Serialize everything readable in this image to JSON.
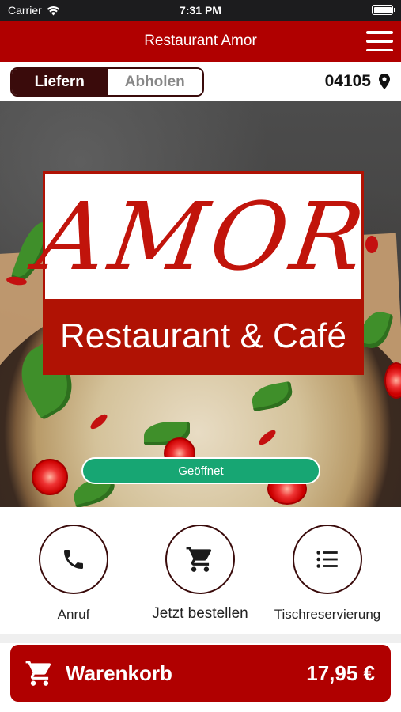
{
  "status_bar": {
    "carrier": "Carrier",
    "time": "7:31 PM"
  },
  "header": {
    "title": "Restaurant Amor"
  },
  "order_mode": {
    "deliver": "Liefern",
    "pickup": "Abholen",
    "selected": "Liefern"
  },
  "location": {
    "postal_code": "04105"
  },
  "hero": {
    "logo_brand": "AMOR",
    "logo_subtitle": "Restaurant & Café",
    "status": "Geöffnet"
  },
  "actions": [
    {
      "label": "Anruf",
      "icon": "phone-icon"
    },
    {
      "label": "Jetzt bestellen",
      "icon": "cart-icon"
    },
    {
      "label": "Tischreservierung",
      "icon": "list-icon"
    }
  ],
  "cart": {
    "label": "Warenkorb",
    "total": "17,95 €"
  },
  "colors": {
    "brand_red": "#b00000",
    "dark_maroon": "#3a0b0b",
    "open_green": "#17a673"
  }
}
